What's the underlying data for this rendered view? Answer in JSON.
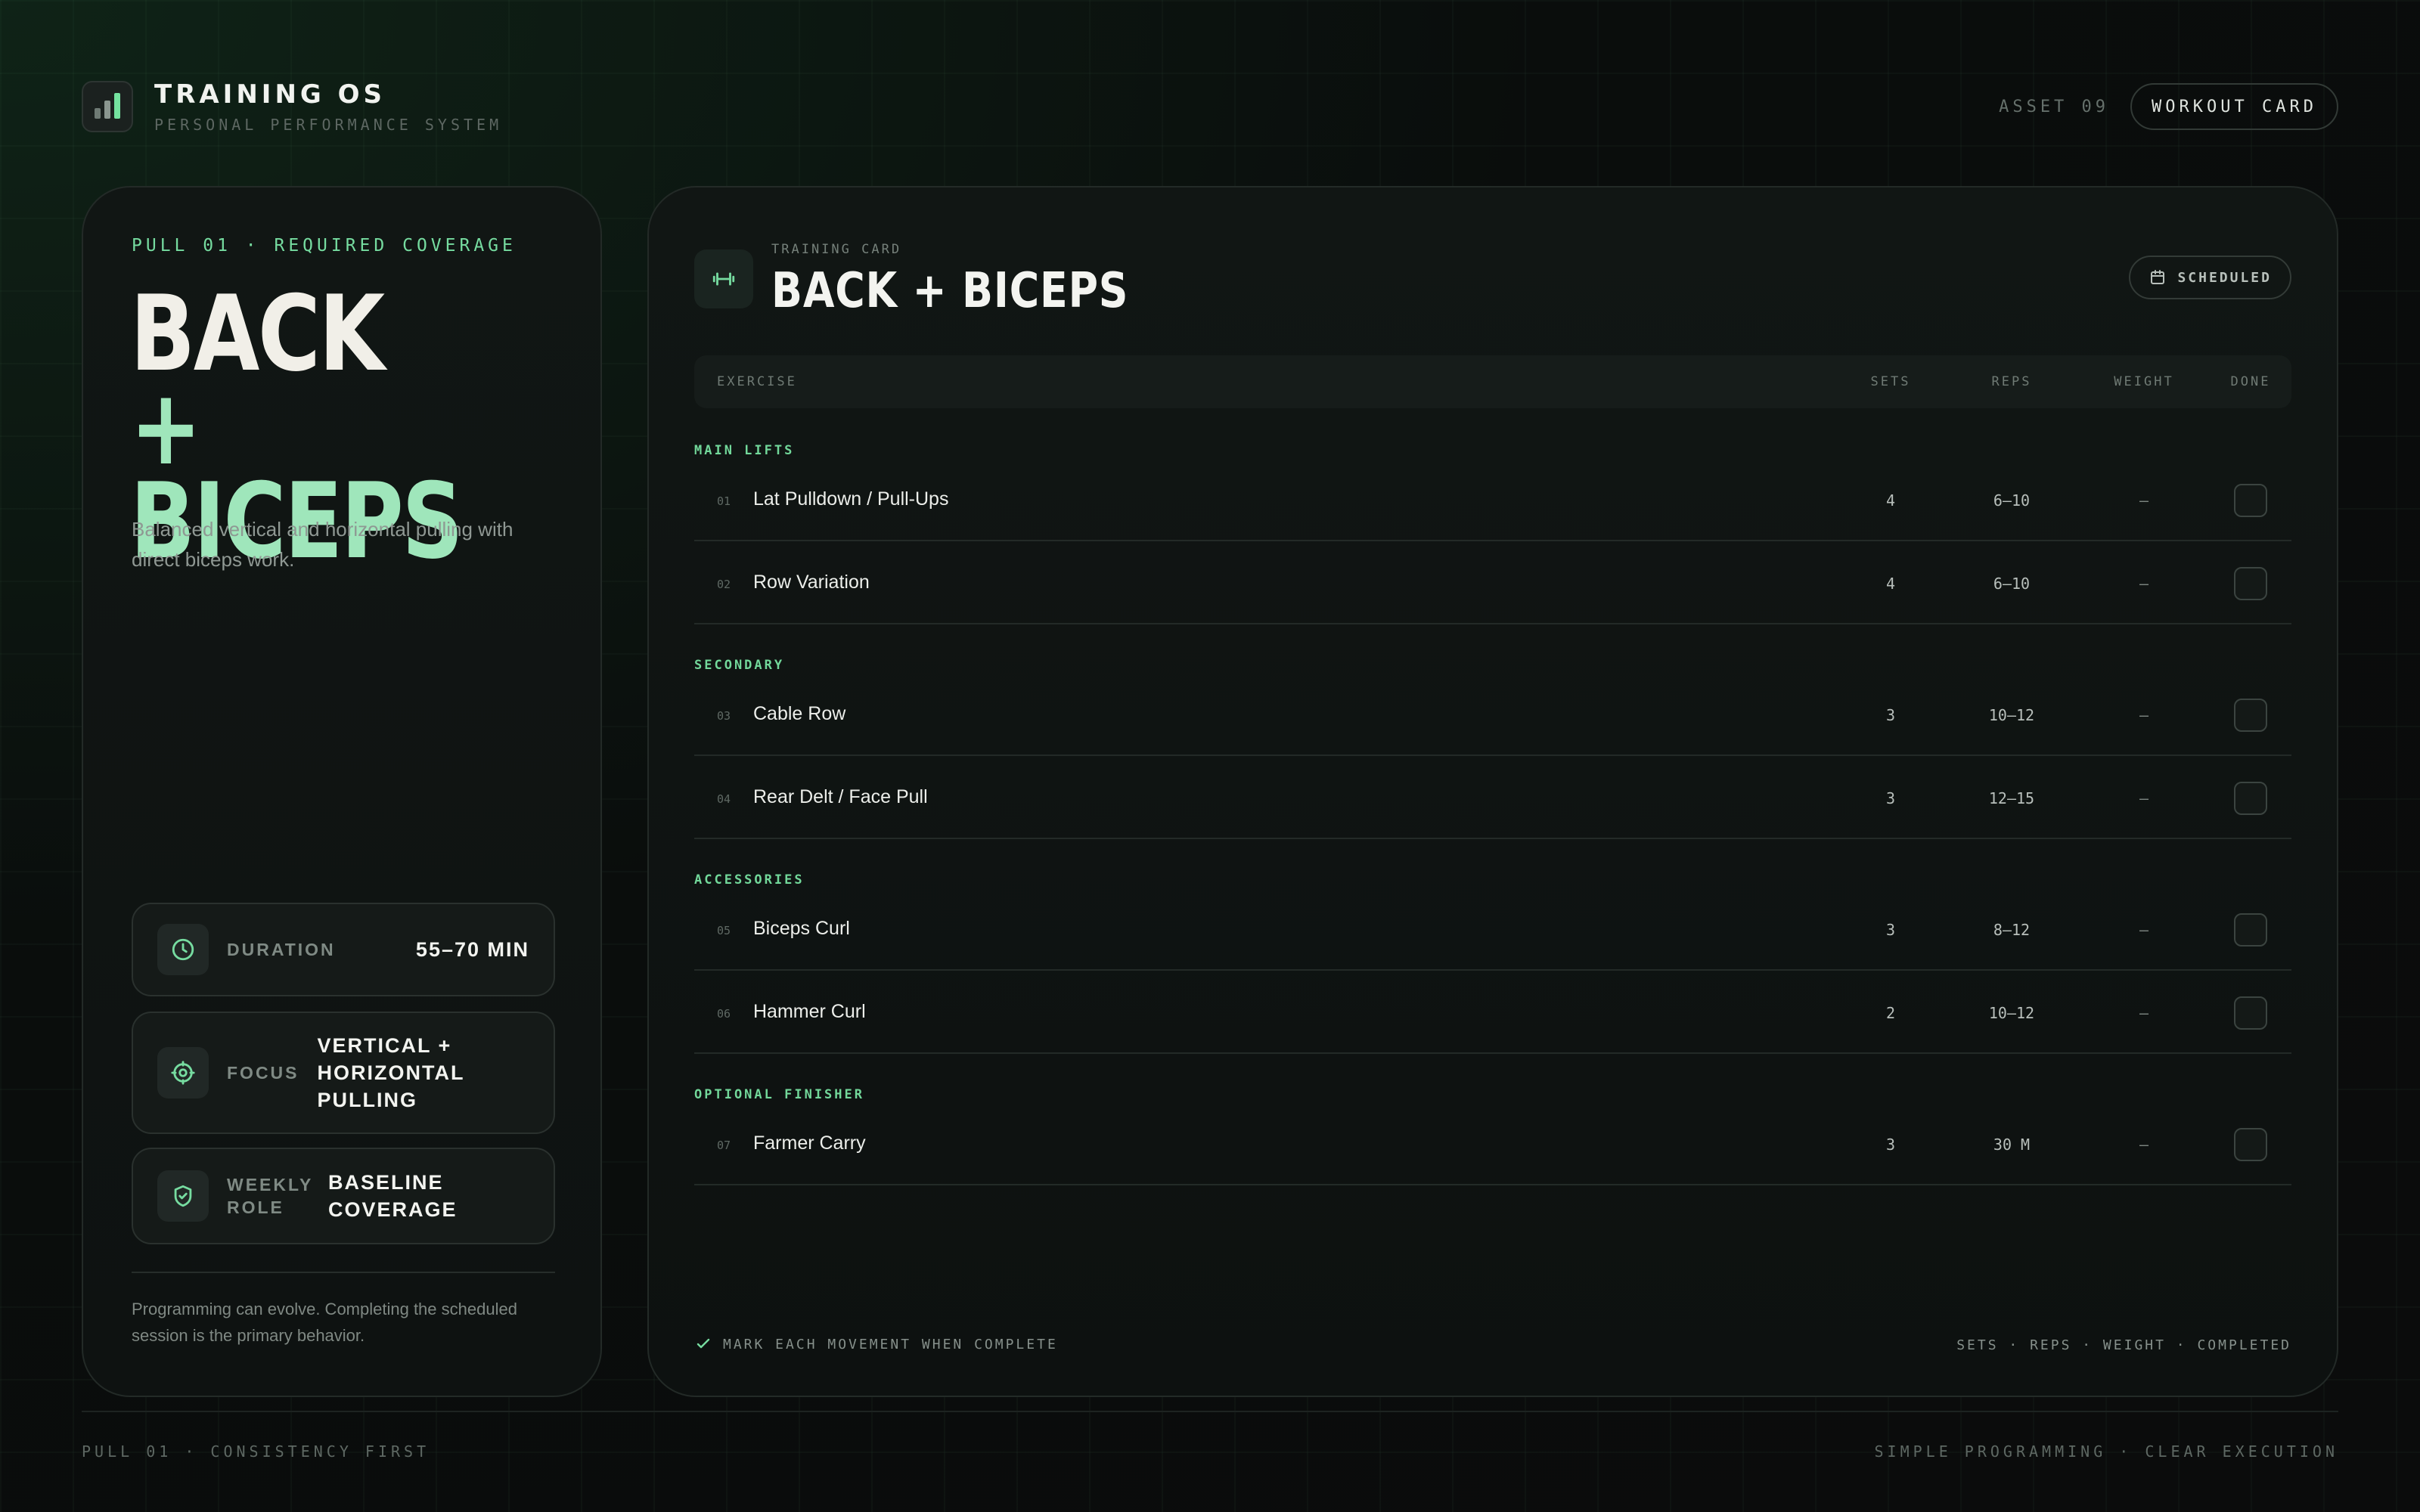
{
  "brand": {
    "title": "TRAINING OS",
    "subtitle": "PERSONAL PERFORMANCE SYSTEM",
    "icon": "bar-chart-icon"
  },
  "header": {
    "asset_label": "ASSET 09",
    "pill_label": "WORKOUT CARD"
  },
  "summary": {
    "kicker": "PULL 01 · REQUIRED COVERAGE",
    "title_line1": "BACK",
    "title_line2": "+ BICEPS",
    "description": "Balanced vertical and horizontal pulling with direct biceps work.",
    "stats": [
      {
        "icon": "clock-icon",
        "label": "DURATION",
        "value": "55–70 MIN"
      },
      {
        "icon": "target-icon",
        "label": "FOCUS",
        "value": "VERTICAL + HORIZONTAL PULLING"
      },
      {
        "icon": "shield-check-icon",
        "label": "WEEKLY ROLE",
        "value": "BASELINE COVERAGE"
      }
    ],
    "note": "Programming can evolve. Completing the scheduled session is the primary behavior."
  },
  "card": {
    "icon": "dumbbell-icon",
    "kicker": "TRAINING CARD",
    "title": "BACK + BICEPS",
    "status_icon": "calendar-icon",
    "status": "SCHEDULED",
    "columns": {
      "exercise": "EXERCISE",
      "sets": "SETS",
      "reps": "REPS",
      "weight": "WEIGHT",
      "done": "DONE"
    },
    "sections": [
      {
        "label": "MAIN LIFTS",
        "rows": [
          {
            "num": "01",
            "name": "Lat Pulldown / Pull-Ups",
            "sets": "4",
            "reps": "6–10",
            "weight": "–",
            "done": false
          },
          {
            "num": "02",
            "name": "Row Variation",
            "sets": "4",
            "reps": "6–10",
            "weight": "–",
            "done": false
          }
        ]
      },
      {
        "label": "SECONDARY",
        "rows": [
          {
            "num": "03",
            "name": "Cable Row",
            "sets": "3",
            "reps": "10–12",
            "weight": "–",
            "done": false
          },
          {
            "num": "04",
            "name": "Rear Delt / Face Pull",
            "sets": "3",
            "reps": "12–15",
            "weight": "–",
            "done": false
          }
        ]
      },
      {
        "label": "ACCESSORIES",
        "rows": [
          {
            "num": "05",
            "name": "Biceps Curl",
            "sets": "3",
            "reps": "8–12",
            "weight": "–",
            "done": false
          },
          {
            "num": "06",
            "name": "Hammer Curl",
            "sets": "2",
            "reps": "10–12",
            "weight": "–",
            "done": false
          }
        ]
      },
      {
        "label": "OPTIONAL FINISHER",
        "rows": [
          {
            "num": "07",
            "name": "Farmer Carry",
            "sets": "3",
            "reps": "30 M",
            "weight": "–",
            "done": false
          }
        ]
      }
    ],
    "footer_left": "MARK EACH MOVEMENT WHEN COMPLETE",
    "footer_right": "SETS · REPS · WEIGHT · COMPLETED"
  },
  "footer": {
    "left": "PULL 01 · CONSISTENCY FIRST",
    "right": "SIMPLE PROGRAMMING · CLEAR EXECUTION"
  },
  "colors": {
    "accent": "#76dca0",
    "accent_light": "#9fe6bb",
    "background": "#0a0d0c",
    "panel": "#111614"
  }
}
